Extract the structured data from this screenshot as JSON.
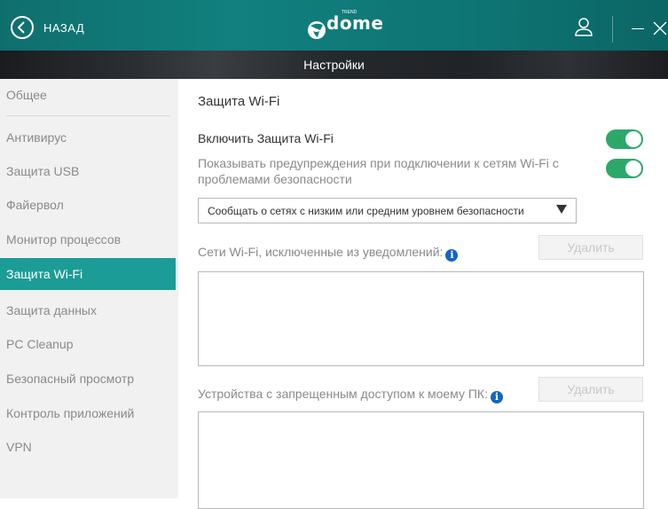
{
  "titlebar": {
    "back_label": "НАЗАД",
    "logo_text": "dome",
    "logo_tm": "TREND"
  },
  "header": {
    "title": "Настройки"
  },
  "sidebar": {
    "items": [
      {
        "label": "Общее"
      },
      {
        "label": "Антивирус"
      },
      {
        "label": "Защита USB"
      },
      {
        "label": "Файервол"
      },
      {
        "label": "Монитор процессов"
      },
      {
        "label": "Защита Wi-Fi"
      },
      {
        "label": "Защита данных"
      },
      {
        "label": "PC Cleanup"
      },
      {
        "label": "Безопасный просмотр"
      },
      {
        "label": "Контроль приложений"
      },
      {
        "label": "VPN"
      }
    ],
    "active_index": 5
  },
  "main": {
    "section_title": "Защита Wi-Fi",
    "enable_label": "Включить Защита Wi-Fi",
    "enable_on": true,
    "warn_label": "Показывать предупреждения при подключении к сетям Wi-Fi с проблемами безопасности",
    "warn_on": true,
    "select_value": "Сообщать о сетях с низким или средним уровнем безопасности",
    "excluded_label": "Сети Wi-Fi, исключенные из уведомлений:",
    "excluded_delete": "Удалить",
    "devices_label": "Устройства с запрещенным доступом к моему ПК:",
    "devices_delete": "Удалить",
    "info_glyph": "i"
  },
  "colors": {
    "accent": "#1c9c96",
    "titlebar": "#11807e",
    "toggle_on": "#2da86b",
    "info": "#1565c0"
  }
}
